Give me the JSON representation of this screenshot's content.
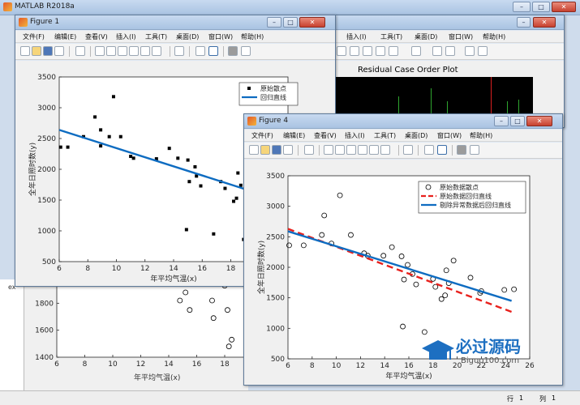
{
  "matlab": {
    "title": "MATLAB R2018a",
    "status_row_label": "行",
    "status_row_value": "1",
    "status_col_label": "列",
    "status_col_value": "1",
    "side_label": "ex"
  },
  "menus": [
    "文件(F)",
    "编辑(E)",
    "查看(V)",
    "插入(I)",
    "工具(T)",
    "桌面(D)",
    "窗口(W)",
    "帮助(H)"
  ],
  "figure_back": {
    "menus": [
      "插入(I)",
      "工具(T)",
      "桌面(D)",
      "窗口(W)",
      "帮助(H)"
    ],
    "title": "Residual Case Order Plot"
  },
  "figure1": {
    "title": "Figure 1",
    "legend": [
      "原始散点",
      "回归直线"
    ]
  },
  "figure4": {
    "title": "Figure 4",
    "legend": [
      "原始数据散点",
      "原始数据回归直线",
      "剔除异常数据后回归直线"
    ]
  },
  "behind_plot": {
    "xlabel": "年平均气温(x)"
  },
  "watermark": {
    "brand": "必过源码",
    "url": "Biguo100.com"
  },
  "chart_data": [
    {
      "type": "scatter",
      "ylabel": "全年日照时数(y)",
      "xlabel": "年平均气温(x)",
      "xlim": [
        6,
        22
      ],
      "ylim": [
        500,
        3500
      ],
      "xticks": [
        6,
        8,
        10,
        12,
        14,
        16,
        18,
        20
      ],
      "yticks": [
        500,
        1000,
        1500,
        2000,
        2500,
        3000,
        3500
      ],
      "marker": "filled-square",
      "points": [
        [
          6.1,
          2360
        ],
        [
          6.6,
          2360
        ],
        [
          7.7,
          2530
        ],
        [
          8.5,
          2850
        ],
        [
          8.9,
          2640
        ],
        [
          8.9,
          2380
        ],
        [
          9.5,
          2530
        ],
        [
          9.8,
          3180
        ],
        [
          10.3,
          2530
        ],
        [
          11,
          2210
        ],
        [
          11.2,
          2180
        ],
        [
          12.8,
          2170
        ],
        [
          13.7,
          2340
        ],
        [
          14.3,
          2180
        ],
        [
          14.9,
          1020
        ],
        [
          15.0,
          2150
        ],
        [
          15.1,
          1800
        ],
        [
          15.5,
          2040
        ],
        [
          15.6,
          1890
        ],
        [
          15.9,
          1730
        ],
        [
          16.8,
          950
        ],
        [
          17.3,
          1800
        ],
        [
          17.6,
          1690
        ],
        [
          18.2,
          1480
        ],
        [
          18.4,
          1530
        ],
        [
          18.5,
          1940
        ],
        [
          18.7,
          1740
        ],
        [
          18.9,
          860
        ],
        [
          19.1,
          2120
        ],
        [
          20.8,
          1540
        ]
      ],
      "regression_line": [
        [
          6,
          2640
        ],
        [
          21,
          1530
        ]
      ],
      "color_line": "#0e6cc1",
      "legend_position": "top-right"
    },
    {
      "type": "scatter",
      "ylabel": "全年日照时数(y)",
      "xlabel": "年平均气温(x)",
      "xlim": [
        6,
        26
      ],
      "ylim": [
        500,
        3500
      ],
      "xticks": [
        6,
        8,
        10,
        12,
        14,
        16,
        18,
        20,
        22,
        24,
        26
      ],
      "yticks": [
        500,
        1000,
        1500,
        2000,
        2500,
        3000,
        3500
      ],
      "marker": "open-circle",
      "points": [
        [
          6.1,
          2360
        ],
        [
          7.3,
          2360
        ],
        [
          8.8,
          2530
        ],
        [
          9.0,
          2850
        ],
        [
          9.6,
          2390
        ],
        [
          10.3,
          3180
        ],
        [
          11.2,
          2530
        ],
        [
          12.3,
          2230
        ],
        [
          12.6,
          2190
        ],
        [
          13.9,
          2190
        ],
        [
          14.6,
          2330
        ],
        [
          15.4,
          2180
        ],
        [
          15.5,
          1030
        ],
        [
          15.6,
          1800
        ],
        [
          15.9,
          2040
        ],
        [
          16.3,
          1890
        ],
        [
          16.6,
          1720
        ],
        [
          17.3,
          940
        ],
        [
          18.0,
          1810
        ],
        [
          18.2,
          1680
        ],
        [
          18.7,
          1480
        ],
        [
          19.0,
          1540
        ],
        [
          19.1,
          1950
        ],
        [
          19.3,
          1740
        ],
        [
          19.7,
          2110
        ],
        [
          21.1,
          1830
        ],
        [
          21.9,
          1580
        ],
        [
          22.0,
          1610
        ],
        [
          23.9,
          1630
        ],
        [
          24.7,
          1640
        ]
      ],
      "lines": [
        {
          "name": "原始数据回归直线",
          "style": "dashed",
          "color": "#e8211d",
          "points": [
            [
              6,
              2630
            ],
            [
              24.5,
              1270
            ]
          ]
        },
        {
          "name": "剔除异常数据后回归直线",
          "style": "solid",
          "color": "#0e6cc1",
          "points": [
            [
              6,
              2590
            ],
            [
              24.5,
              1450
            ]
          ]
        }
      ],
      "legend_position": "top-right"
    },
    {
      "type": "scatter",
      "xlabel": "年平均气温(x)",
      "xlim": [
        6,
        22
      ],
      "ylim": [
        1400,
        2000
      ],
      "xticks": [
        6,
        8,
        10,
        12,
        14,
        16,
        18,
        20
      ],
      "yticks": [
        1400,
        1600,
        1800,
        2000
      ],
      "marker": "open-circle",
      "points": [
        [
          14.8,
          1820
        ],
        [
          15.2,
          1880
        ],
        [
          15.5,
          1750
        ],
        [
          17.1,
          1820
        ],
        [
          17.2,
          1690
        ],
        [
          18.0,
          1930
        ],
        [
          18.2,
          1750
        ],
        [
          18.3,
          1480
        ],
        [
          18.5,
          1530
        ],
        [
          20.8,
          1540
        ]
      ]
    }
  ]
}
